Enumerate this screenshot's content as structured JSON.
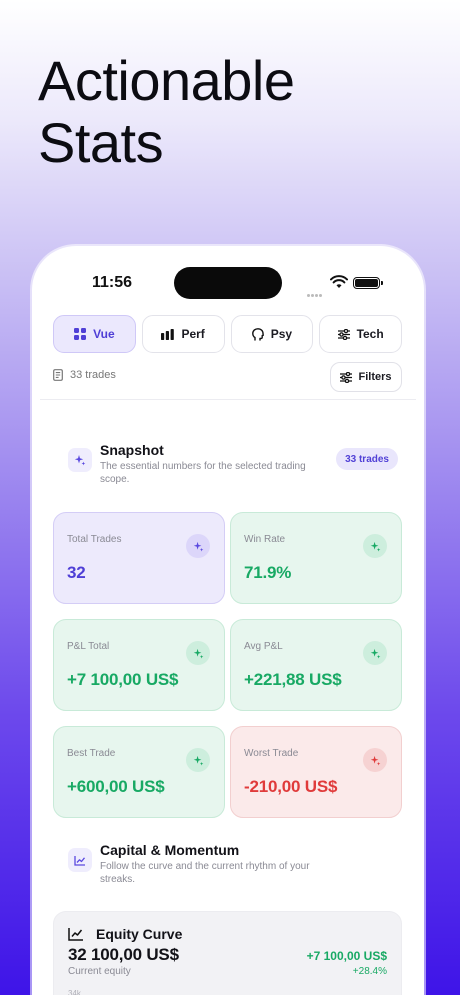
{
  "headline": {
    "line1": "Actionable",
    "line2": "Stats"
  },
  "status_bar": {
    "time": "11:56"
  },
  "tabs": [
    {
      "label": "Vue",
      "icon": "grid-icon",
      "active": true
    },
    {
      "label": "Perf",
      "icon": "bar-chart-icon",
      "active": false
    },
    {
      "label": "Psy",
      "icon": "head-icon",
      "active": false
    },
    {
      "label": "Tech",
      "icon": "sliders-icon",
      "active": false
    }
  ],
  "toolbar": {
    "trades_count": "33 trades",
    "filters_label": "Filters"
  },
  "snapshot": {
    "title": "Snapshot",
    "subtitle": "The essential numbers for the selected trading scope.",
    "badge": "33 trades"
  },
  "cards": [
    {
      "label": "Total Trades",
      "value": "32",
      "tone": "purple"
    },
    {
      "label": "Win Rate",
      "value": "71.9%",
      "tone": "green"
    },
    {
      "label": "P&L Total",
      "value": "+7 100,00 US$",
      "tone": "green"
    },
    {
      "label": "Avg P&L",
      "value": "+221,88 US$",
      "tone": "green"
    },
    {
      "label": "Best Trade",
      "value": "+600,00 US$",
      "tone": "green"
    },
    {
      "label": "Worst Trade",
      "value": "-210,00 US$",
      "tone": "red"
    }
  ],
  "capital": {
    "title": "Capital & Momentum",
    "subtitle": "Follow the curve and the current rhythm of your streaks."
  },
  "equity": {
    "title": "Equity Curve",
    "value": "32 100,00 US$",
    "caption": "Current equity",
    "delta": "+7 100,00 US$",
    "delta_pct": "+28.4%",
    "tick": "34k"
  },
  "colors": {
    "accent": "#4f3fd6",
    "positive": "#18a964",
    "negative": "#e03b3b"
  }
}
